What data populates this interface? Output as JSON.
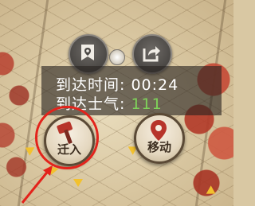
{
  "info": {
    "arrival_time_label": "到达时间:",
    "arrival_time_value": "00:24",
    "arrival_morale_label": "到达士气:",
    "arrival_morale_value": "111"
  },
  "actions": {
    "move_in_label": "迁入",
    "move_label": "移动"
  },
  "icons": {
    "banner": "banner-flag-icon",
    "share": "share-arrow-icon",
    "move_in": "hammer-icon",
    "move": "map-pin-icon"
  },
  "colors": {
    "morale_value": "#7fd35a",
    "highlight": "#e3231b"
  }
}
